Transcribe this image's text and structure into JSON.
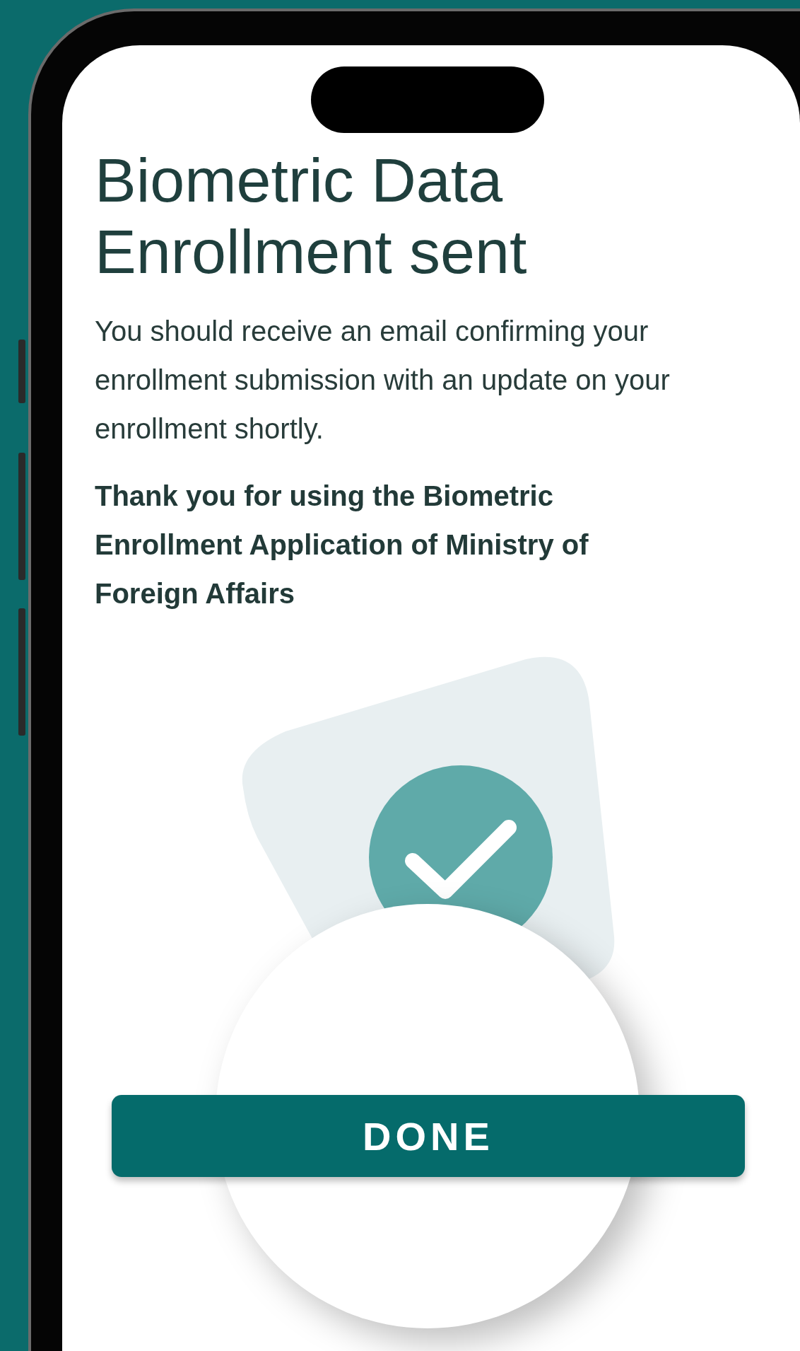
{
  "title": "Biometric Data Enrollment sent",
  "message": "You should receive an email confirming your enrollment submission with an update on your enrollment shortly.",
  "thanks": "Thank you for using the Biometric Enrollment Application of Ministry of Foreign Affairs",
  "done_button": {
    "label": "DONE"
  }
}
